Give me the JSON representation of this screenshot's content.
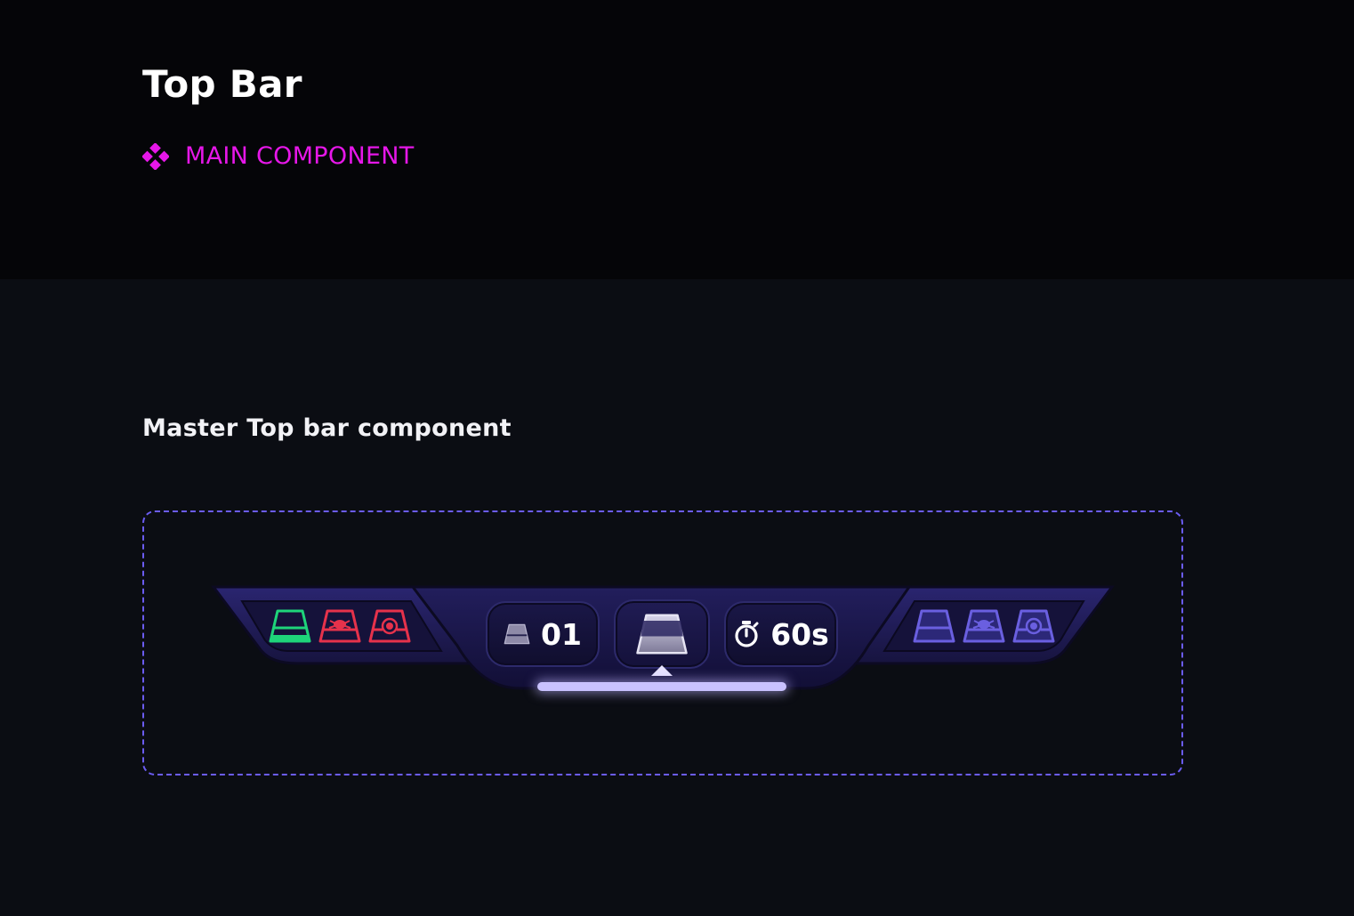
{
  "header": {
    "title": "Top Bar",
    "component_tag": "MAIN COMPONENT",
    "tag_color": "#e617e8"
  },
  "section": {
    "title": "Master Top bar component"
  },
  "topbar": {
    "left_team": {
      "icons": [
        {
          "name": "base-pad-icon",
          "color": "#1ed47a"
        },
        {
          "name": "spider-pad-icon",
          "color": "#e6324b"
        },
        {
          "name": "target-pad-icon",
          "color": "#e6324b"
        }
      ]
    },
    "round_counter": {
      "icon": "pad-icon",
      "value": "01"
    },
    "center_icon": "active-pad-icon",
    "timer": {
      "icon": "stopwatch-icon",
      "value": "60s"
    },
    "right_team": {
      "icons": [
        {
          "name": "base-pad-icon",
          "color": "#6a5fe0"
        },
        {
          "name": "spider-pad-icon",
          "color": "#6a5fe0"
        },
        {
          "name": "target-pad-icon",
          "color": "#6a5fe0"
        }
      ]
    },
    "accent_color": "#c9c2ff"
  }
}
